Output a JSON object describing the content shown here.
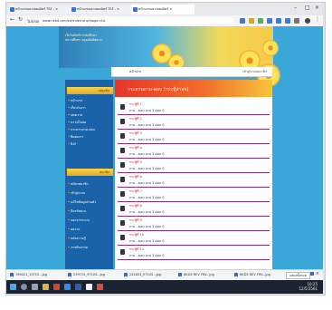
{
  "browser": {
    "tabs": [
      {
        "label": "หน้าแรกและเพลงฉัตร์ TSF - ×"
      },
      {
        "label": "หน้าแรกและเพลงฉัตร์ TSF - ×"
      },
      {
        "label": "หน้าแรกและเพลงฉัตร์ ×"
      }
    ],
    "address": "www.nkbd.com/tsf/index.php?page=list",
    "secure_label": "ไม่ปลอดภัย"
  },
  "site": {
    "header_lines": [
      "เว็บไซต์บริการนักศึกษา",
      "สถานศึกษา ครูคณิตคิดบวก"
    ],
    "menu_label": "หน้าแรก",
    "menu_right": "เข้าสู่ระบบสมาชิก"
  },
  "sidebar": {
    "section1": "เมนูหลัก",
    "section1_items": [
      "หน้าแรก",
      "เกี่ยวกับเรา",
      "บทความ",
      "ดาวน์โหลด",
      "กระดานถาม-ตอบ",
      "ติดต่อเรา",
      "ลิงก์"
    ],
    "section2": "สมาชิก",
    "section2_items": [
      "สมัครสมาชิก",
      "เข้าสู่ระบบ",
      "แก้ไขข้อมูลส่วนตัว",
      "ลืมรหัสผ่าน",
      "ออกจากระบบ",
      "ผลงาน",
      "คลังความรู้",
      "ภาพกิจกรรม"
    ]
  },
  "content": {
    "banner": "กระดานถาม-ตอบ (กระทู้ล่าสุด)",
    "rows": [
      {
        "title": "กระทู้ที่ 1",
        "meta": "ถาม - ตอบ  อ่าน 3  ตอบ 0"
      },
      {
        "title": "กระทู้ที่ 2",
        "meta": "ถาม - ตอบ  อ่าน 3  ตอบ 0"
      },
      {
        "title": "กระทู้ที่ 3",
        "meta": "ถาม - ตอบ  อ่าน 3  ตอบ 0"
      },
      {
        "title": "กระทู้ที่ 4",
        "meta": "ถาม - ตอบ  อ่าน 3  ตอบ 0"
      },
      {
        "title": "กระทู้ที่ 5",
        "meta": "ถาม - ตอบ  อ่าน 3  ตอบ 0"
      },
      {
        "title": "กระทู้ที่ 6",
        "meta": "ถาม - ตอบ  อ่าน 3  ตอบ 0"
      },
      {
        "title": "กระทู้ที่ 7",
        "meta": "ถาม - ตอบ  อ่าน 3  ตอบ 0"
      },
      {
        "title": "กระทู้ที่ 8",
        "meta": "ถาม - ตอบ  อ่าน 3  ตอบ 0"
      },
      {
        "title": "กระทู้ที่ 9",
        "meta": "ถาม - ตอบ  อ่าน 3  ตอบ 0"
      },
      {
        "title": "กระทู้ที่ 10",
        "meta": "ถาม - ตอบ  อ่าน 3  ตอบ 0"
      },
      {
        "title": "กระทู้ที่ 11",
        "meta": "ถาม - ตอบ  อ่าน 3  ตอบ 0"
      }
    ]
  },
  "downloads": [
    {
      "name": "769421_19715...jpg"
    },
    {
      "name": "239719_97105...jpg"
    },
    {
      "name": "241853_97105...jpg"
    },
    {
      "name": "BKD5 REV FRV...jpg"
    },
    {
      "name": "BKD5 REV FRV...jpg"
    }
  ],
  "downloads_show_all": "แสดงทั้งหมด",
  "taskbar": {
    "time": "10:25",
    "date": "12/5/2561"
  },
  "colors": {
    "page_bg": "#3aa7d9",
    "sidebar": "#1b63a8",
    "banner": "#e8342a",
    "accent": "#f7c948"
  }
}
